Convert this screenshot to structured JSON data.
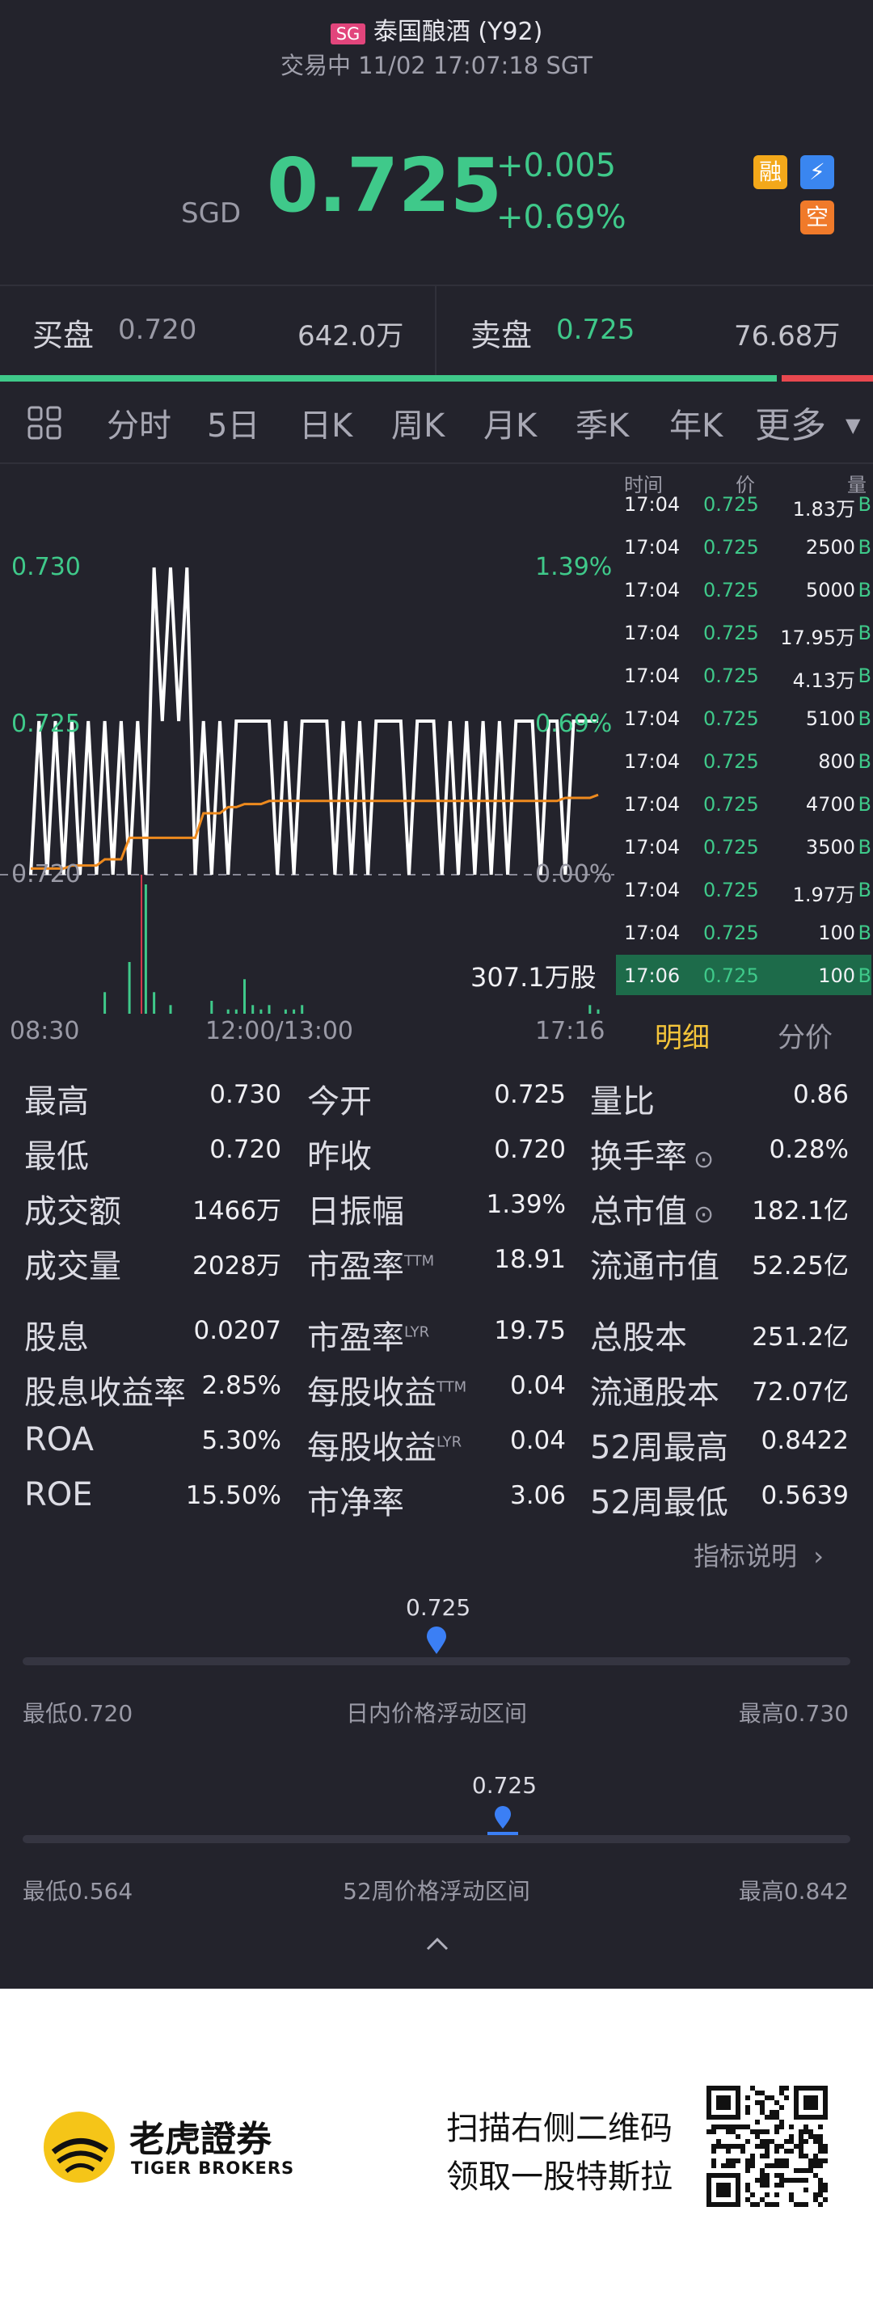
{
  "header": {
    "market_badge": "SG",
    "stock_name": "泰国酿酒 (Y92)",
    "status_line": "交易中 11/02 17:07:18 SGT",
    "currency": "SGD",
    "price": "0.725",
    "change": "+0.005",
    "change_pct": "+0.69%",
    "badges": {
      "margin": "融",
      "flash": "⚡",
      "short": "空"
    }
  },
  "bidask": {
    "bid_label": "买盘",
    "bid_price": "0.720",
    "bid_vol": "642.0万",
    "ask_label": "卖盘",
    "ask_price": "0.725",
    "ask_vol": "76.68万",
    "bid_fraction": 0.89
  },
  "tabs": {
    "items": [
      "分时",
      "5日",
      "日K",
      "周K",
      "月K",
      "季K",
      "年K"
    ],
    "more": "更多",
    "active": "分时"
  },
  "chart": {
    "price_high": "0.730",
    "price_mid": "0.725",
    "price_low": "0.720",
    "pct_high": "1.39%",
    "pct_mid": "0.69%",
    "pct_low": "0.00%",
    "volume_label": "307.1万股",
    "time_start": "08:30",
    "time_mid": "12:00/13:00",
    "time_end": "17:16"
  },
  "chart_data": {
    "type": "line",
    "title": "",
    "xlabel": "",
    "ylabel": "",
    "x_ticks": [
      "08:30",
      "12:00/13:00",
      "17:16"
    ],
    "y_ticks": [
      "0.720",
      "0.725",
      "0.730"
    ],
    "ylim": [
      0.72,
      0.73
    ],
    "series": [
      {
        "name": "",
        "color": "#ffffff",
        "values": [
          0.72,
          0.725,
          0.72,
          0.725,
          0.72,
          0.725,
          0.72,
          0.725,
          0.72,
          0.725,
          0.72,
          0.725,
          0.72,
          0.725,
          0.72,
          0.73,
          0.725,
          0.73,
          0.725,
          0.73,
          0.72,
          0.725,
          0.72,
          0.725,
          0.72,
          0.725,
          0.725,
          0.725,
          0.725,
          0.725,
          0.72,
          0.725,
          0.72,
          0.725,
          0.725,
          0.725,
          0.725,
          0.72,
          0.725,
          0.72,
          0.725,
          0.72,
          0.725,
          0.725,
          0.725,
          0.725,
          0.72,
          0.725,
          0.725,
          0.725,
          0.72,
          0.725,
          0.72,
          0.725,
          0.72,
          0.725,
          0.72,
          0.725,
          0.72,
          0.725,
          0.725,
          0.725,
          0.72,
          0.725,
          0.725,
          0.72,
          0.725,
          0.725,
          0.725,
          0.725
        ]
      },
      {
        "name": "",
        "color": "#ee8a1e",
        "values": [
          0.7202,
          0.7202,
          0.7202,
          0.7202,
          0.7202,
          0.7203,
          0.7203,
          0.7203,
          0.7203,
          0.7205,
          0.7205,
          0.7205,
          0.7212,
          0.7212,
          0.7212,
          0.7212,
          0.7212,
          0.7212,
          0.7212,
          0.7212,
          0.7212,
          0.722,
          0.722,
          0.722,
          0.7222,
          0.7222,
          0.7223,
          0.7223,
          0.7223,
          0.7224,
          0.7224,
          0.7224,
          0.7224,
          0.7224,
          0.7224,
          0.7224,
          0.7224,
          0.7224,
          0.7224,
          0.7224,
          0.7224,
          0.7224,
          0.7224,
          0.7224,
          0.7224,
          0.7224,
          0.7224,
          0.7224,
          0.7224,
          0.7224,
          0.7224,
          0.7224,
          0.7224,
          0.7224,
          0.7224,
          0.7224,
          0.7224,
          0.7224,
          0.7224,
          0.7224,
          0.7224,
          0.7224,
          0.7224,
          0.7224,
          0.7224,
          0.7225,
          0.7225,
          0.7225,
          0.7225,
          0.7226
        ]
      }
    ],
    "volume": [
      0,
      0,
      0,
      0,
      0,
      0,
      0,
      0,
      0,
      5,
      0,
      0,
      12,
      0,
      30,
      5,
      0,
      2,
      0,
      0,
      0,
      0,
      3,
      0,
      1,
      1,
      8,
      2,
      1,
      2,
      0,
      1,
      1,
      2,
      0,
      0,
      0,
      0,
      0,
      0,
      0,
      0,
      0,
      0,
      0,
      0,
      0,
      0,
      0,
      0,
      0,
      0,
      0,
      0,
      0,
      0,
      0,
      0,
      0,
      0,
      0,
      0,
      0,
      0,
      0,
      0,
      0,
      0,
      2,
      1
    ],
    "volume_ylim": [
      0,
      30
    ]
  },
  "tape": {
    "headers": {
      "time": "时间",
      "price": "价",
      "vol": "量"
    },
    "rows": [
      {
        "time": "17:04",
        "price": "0.725",
        "vol": "1.83万",
        "side": "B"
      },
      {
        "time": "17:04",
        "price": "0.725",
        "vol": "2500",
        "side": "B"
      },
      {
        "time": "17:04",
        "price": "0.725",
        "vol": "5000",
        "side": "B"
      },
      {
        "time": "17:04",
        "price": "0.725",
        "vol": "17.95万",
        "side": "B"
      },
      {
        "time": "17:04",
        "price": "0.725",
        "vol": "4.13万",
        "side": "B"
      },
      {
        "time": "17:04",
        "price": "0.725",
        "vol": "5100",
        "side": "B"
      },
      {
        "time": "17:04",
        "price": "0.725",
        "vol": "800",
        "side": "B"
      },
      {
        "time": "17:04",
        "price": "0.725",
        "vol": "4700",
        "side": "B"
      },
      {
        "time": "17:04",
        "price": "0.725",
        "vol": "3500",
        "side": "B"
      },
      {
        "time": "17:04",
        "price": "0.725",
        "vol": "1.97万",
        "side": "B"
      },
      {
        "time": "17:04",
        "price": "0.725",
        "vol": "100",
        "side": "B"
      },
      {
        "time": "17:06",
        "price": "0.725",
        "vol": "100",
        "side": "B"
      }
    ],
    "tab_detail": "明细",
    "tab_price": "分价"
  },
  "stats": {
    "col1": [
      {
        "label": "最高",
        "value": "0.730"
      },
      {
        "label": "最低",
        "value": "0.720"
      },
      {
        "label": "成交额",
        "value": "1466万"
      },
      {
        "label": "成交量",
        "value": "2028万"
      },
      {
        "label": "股息",
        "value": "0.0207"
      },
      {
        "label": "股息收益率",
        "value": "2.85%"
      },
      {
        "label": "ROA",
        "value": "5.30%"
      },
      {
        "label": "ROE",
        "value": "15.50%"
      }
    ],
    "col2": [
      {
        "label": "今开",
        "value": "0.725",
        "sup": ""
      },
      {
        "label": "昨收",
        "value": "0.720",
        "sup": ""
      },
      {
        "label": "日振幅",
        "value": "1.39%",
        "sup": ""
      },
      {
        "label": "市盈率",
        "value": "18.91",
        "sup": "TTM"
      },
      {
        "label": "市盈率",
        "value": "19.75",
        "sup": "LYR"
      },
      {
        "label": "每股收益",
        "value": "0.04",
        "sup": "TTM"
      },
      {
        "label": "每股收益",
        "value": "0.04",
        "sup": "LYR"
      },
      {
        "label": "市净率",
        "value": "3.06",
        "sup": ""
      }
    ],
    "col3": [
      {
        "label": "量比",
        "value": "0.86",
        "info": false
      },
      {
        "label": "换手率",
        "value": "0.28%",
        "info": true
      },
      {
        "label": "总市值",
        "value": "182.1亿",
        "info": true
      },
      {
        "label": "流通市值",
        "value": "52.25亿",
        "info": false
      },
      {
        "label": "总股本",
        "value": "251.2亿",
        "info": false
      },
      {
        "label": "流通股本",
        "value": "72.07亿",
        "info": false
      },
      {
        "label": "52周最高",
        "value": "0.8422",
        "info": false
      },
      {
        "label": "52周最低",
        "value": "0.5639",
        "info": false
      }
    ],
    "explain_link": "指标说明"
  },
  "ranges": {
    "day": {
      "current": "0.725",
      "low_label": "最低0.720",
      "title": "日内价格浮动区间",
      "high_label": "最高0.730",
      "position": 0.5
    },
    "week52": {
      "current": "0.725",
      "low_label": "最低0.564",
      "title": "52周价格浮动区间",
      "high_label": "最高0.842",
      "position": 0.58
    }
  },
  "footer": {
    "brand_cn": "老虎證券",
    "brand_en": "TIGER BROKERS",
    "promo_line1": "扫描右侧二维码",
    "promo_line2": "领取一股特斯拉"
  },
  "colors": {
    "up": "#3fc98a",
    "down": "#e8484f",
    "accent": "#f5c53a",
    "marker": "#3b7ff5"
  }
}
